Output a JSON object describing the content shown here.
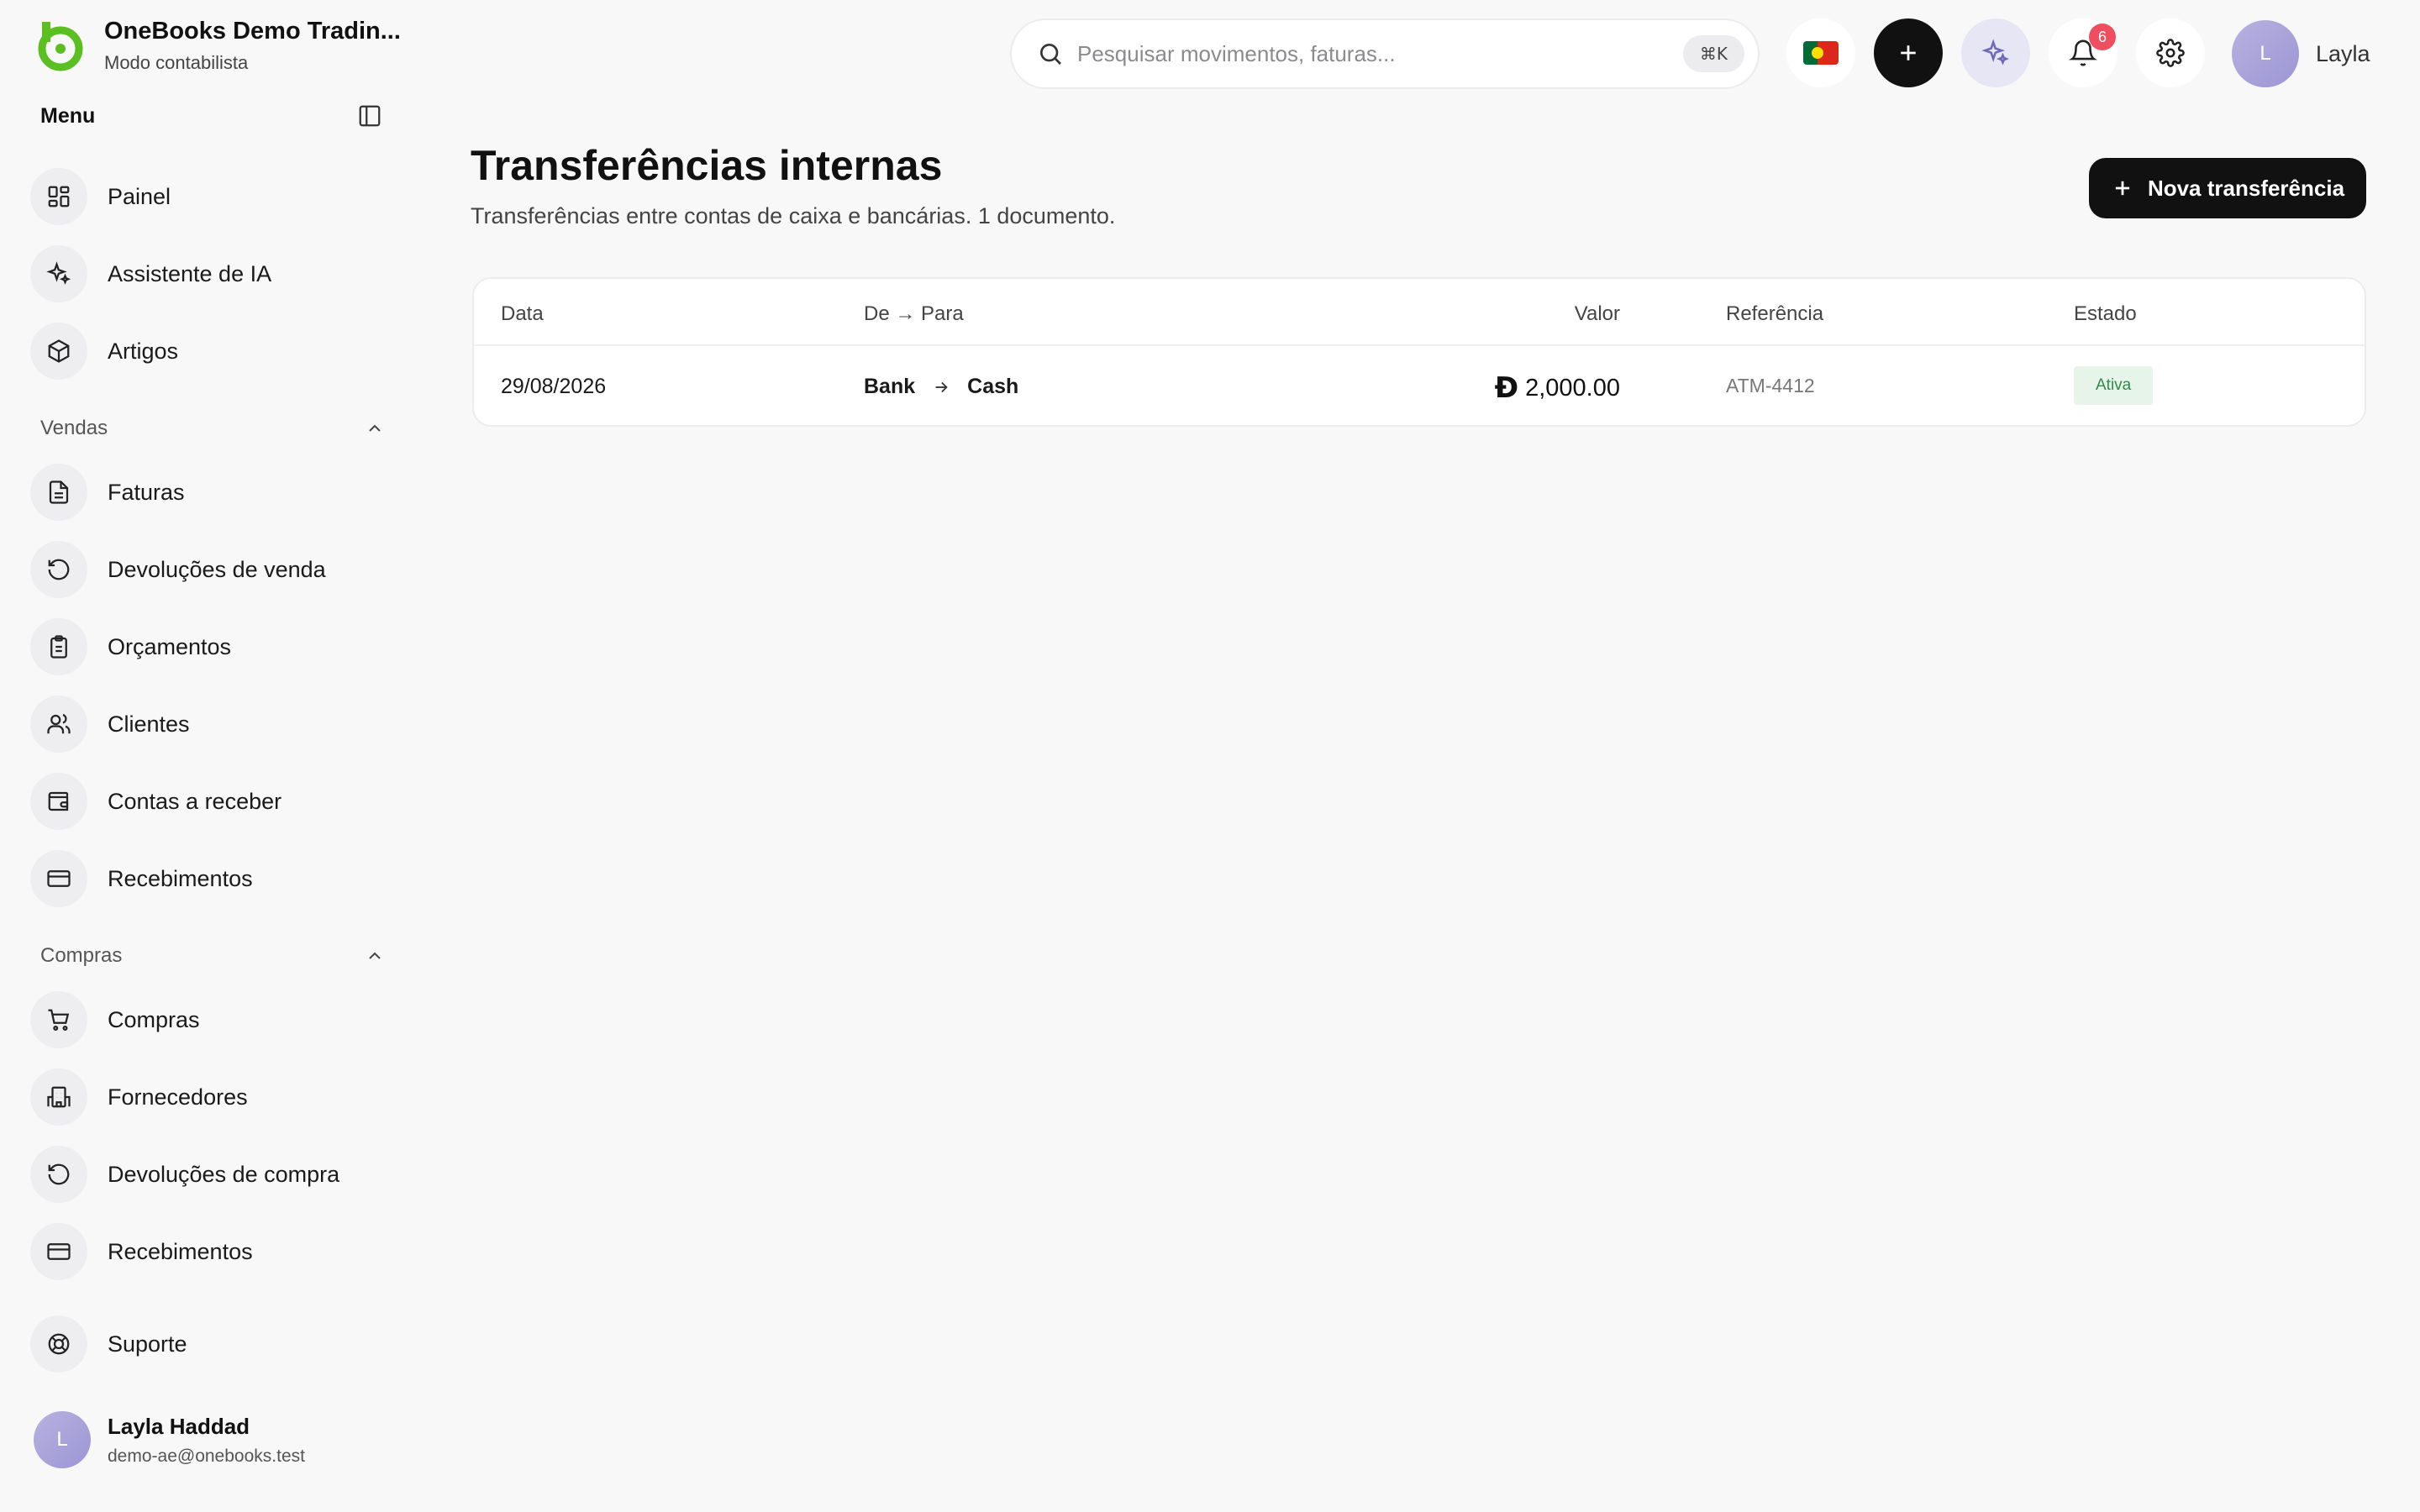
{
  "brand": {
    "name": "OneBooks Demo Tradin...",
    "mode": "Modo contabilista"
  },
  "menu": {
    "title": "Menu"
  },
  "nav": {
    "top": [
      {
        "label": "Painel",
        "icon": "dashboard-icon"
      },
      {
        "label": "Assistente de IA",
        "icon": "sparkles-icon"
      },
      {
        "label": "Artigos",
        "icon": "box-icon"
      }
    ],
    "sales": {
      "title": "Vendas",
      "items": [
        {
          "label": "Faturas",
          "icon": "file-text-icon"
        },
        {
          "label": "Devoluções de venda",
          "icon": "rotate-ccw-icon"
        },
        {
          "label": "Orçamentos",
          "icon": "clipboard-icon"
        },
        {
          "label": "Clientes",
          "icon": "users-icon"
        },
        {
          "label": "Contas a receber",
          "icon": "wallet-icon"
        },
        {
          "label": "Recebimentos",
          "icon": "credit-card-icon"
        }
      ]
    },
    "purchases": {
      "title": "Compras",
      "items": [
        {
          "label": "Compras",
          "icon": "cart-icon"
        },
        {
          "label": "Fornecedores",
          "icon": "building-icon"
        },
        {
          "label": "Devoluções de compra",
          "icon": "rotate-ccw-icon"
        },
        {
          "label": "Recebimentos",
          "icon": "credit-card-icon"
        }
      ]
    },
    "support": {
      "label": "Suporte",
      "icon": "lifebuoy-icon"
    }
  },
  "user": {
    "initial": "L",
    "name": "Layla Haddad",
    "email": "demo-ae@onebooks.test",
    "short_name": "Layla"
  },
  "search": {
    "placeholder": "Pesquisar movimentos, faturas...",
    "shortcut": "⌘K"
  },
  "notifications": {
    "count": "6"
  },
  "page": {
    "title": "Transferências internas",
    "subtitle": "Transferências entre contas de caixa e bancárias. 1 documento.",
    "new_button": "Nova transferência"
  },
  "table": {
    "columns": {
      "date": "Data",
      "route": "De → Para",
      "value": "Valor",
      "reference": "Referência",
      "status": "Estado"
    },
    "rows": [
      {
        "date": "29/08/2026",
        "from": "Bank",
        "to": "Cash",
        "currency": "Đ",
        "amount": "2,000.00",
        "reference": "ATM-4412",
        "status": "Ativa"
      }
    ]
  },
  "colors": {
    "accent": "#5bbf21",
    "primary": "#111111",
    "badge": "#ef4d60",
    "status_active_bg": "#e6f4ea",
    "status_active_text": "#2e8b4a"
  }
}
